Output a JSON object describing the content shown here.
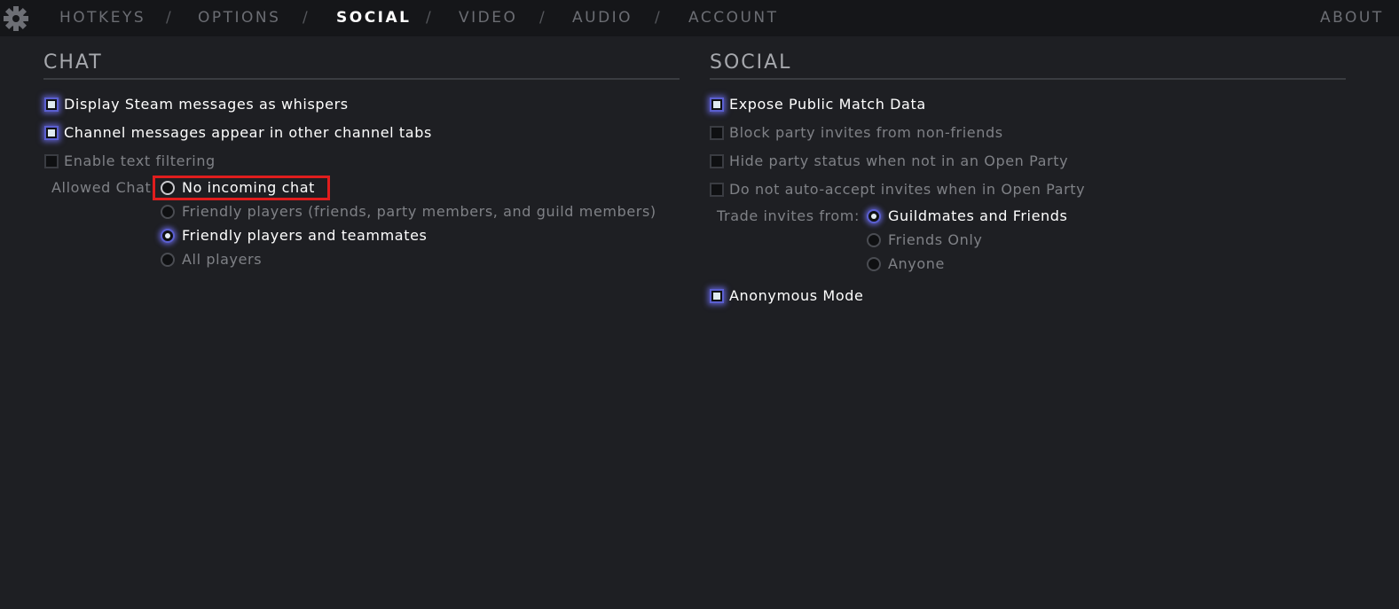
{
  "nav": {
    "tabs": [
      {
        "label": "HOTKEYS"
      },
      {
        "label": "OPTIONS"
      },
      {
        "label": "SOCIAL"
      },
      {
        "label": "VIDEO"
      },
      {
        "label": "AUDIO"
      },
      {
        "label": "ACCOUNT"
      }
    ],
    "separator": "/",
    "about": "ABOUT",
    "active_tab": "SOCIAL"
  },
  "chat": {
    "title": "CHAT",
    "checkboxes": [
      {
        "label": "Display Steam messages as whispers",
        "checked": true
      },
      {
        "label": "Channel messages appear in other channel tabs",
        "checked": true
      },
      {
        "label": "Enable text filtering",
        "checked": false
      }
    ],
    "allowed_chat": {
      "label": "Allowed Chat",
      "options": [
        {
          "label": "No incoming chat",
          "selected": false
        },
        {
          "label": "Friendly players (friends, party members, and guild members)",
          "selected": false
        },
        {
          "label": "Friendly players and teammates",
          "selected": true
        },
        {
          "label": "All players",
          "selected": false
        }
      ]
    }
  },
  "social": {
    "title": "SOCIAL",
    "checkboxes": [
      {
        "label": "Expose Public Match Data",
        "checked": true
      },
      {
        "label": "Block party invites from non-friends",
        "checked": false
      },
      {
        "label": "Hide party status when not in an Open Party",
        "checked": false
      },
      {
        "label": "Do not auto-accept invites when in Open Party",
        "checked": false
      }
    ],
    "trade_invites": {
      "label": "Trade invites from:",
      "options": [
        {
          "label": "Guildmates and Friends",
          "selected": true
        },
        {
          "label": "Friends Only",
          "selected": false
        },
        {
          "label": "Anyone",
          "selected": false
        }
      ]
    },
    "anonymous_mode": {
      "label": "Anonymous Mode",
      "checked": true
    }
  },
  "colors": {
    "background": "#1e1f23",
    "topbar": "#151619",
    "accent_glow": "#5a5fd0",
    "highlight_box": "#e01d1d"
  }
}
